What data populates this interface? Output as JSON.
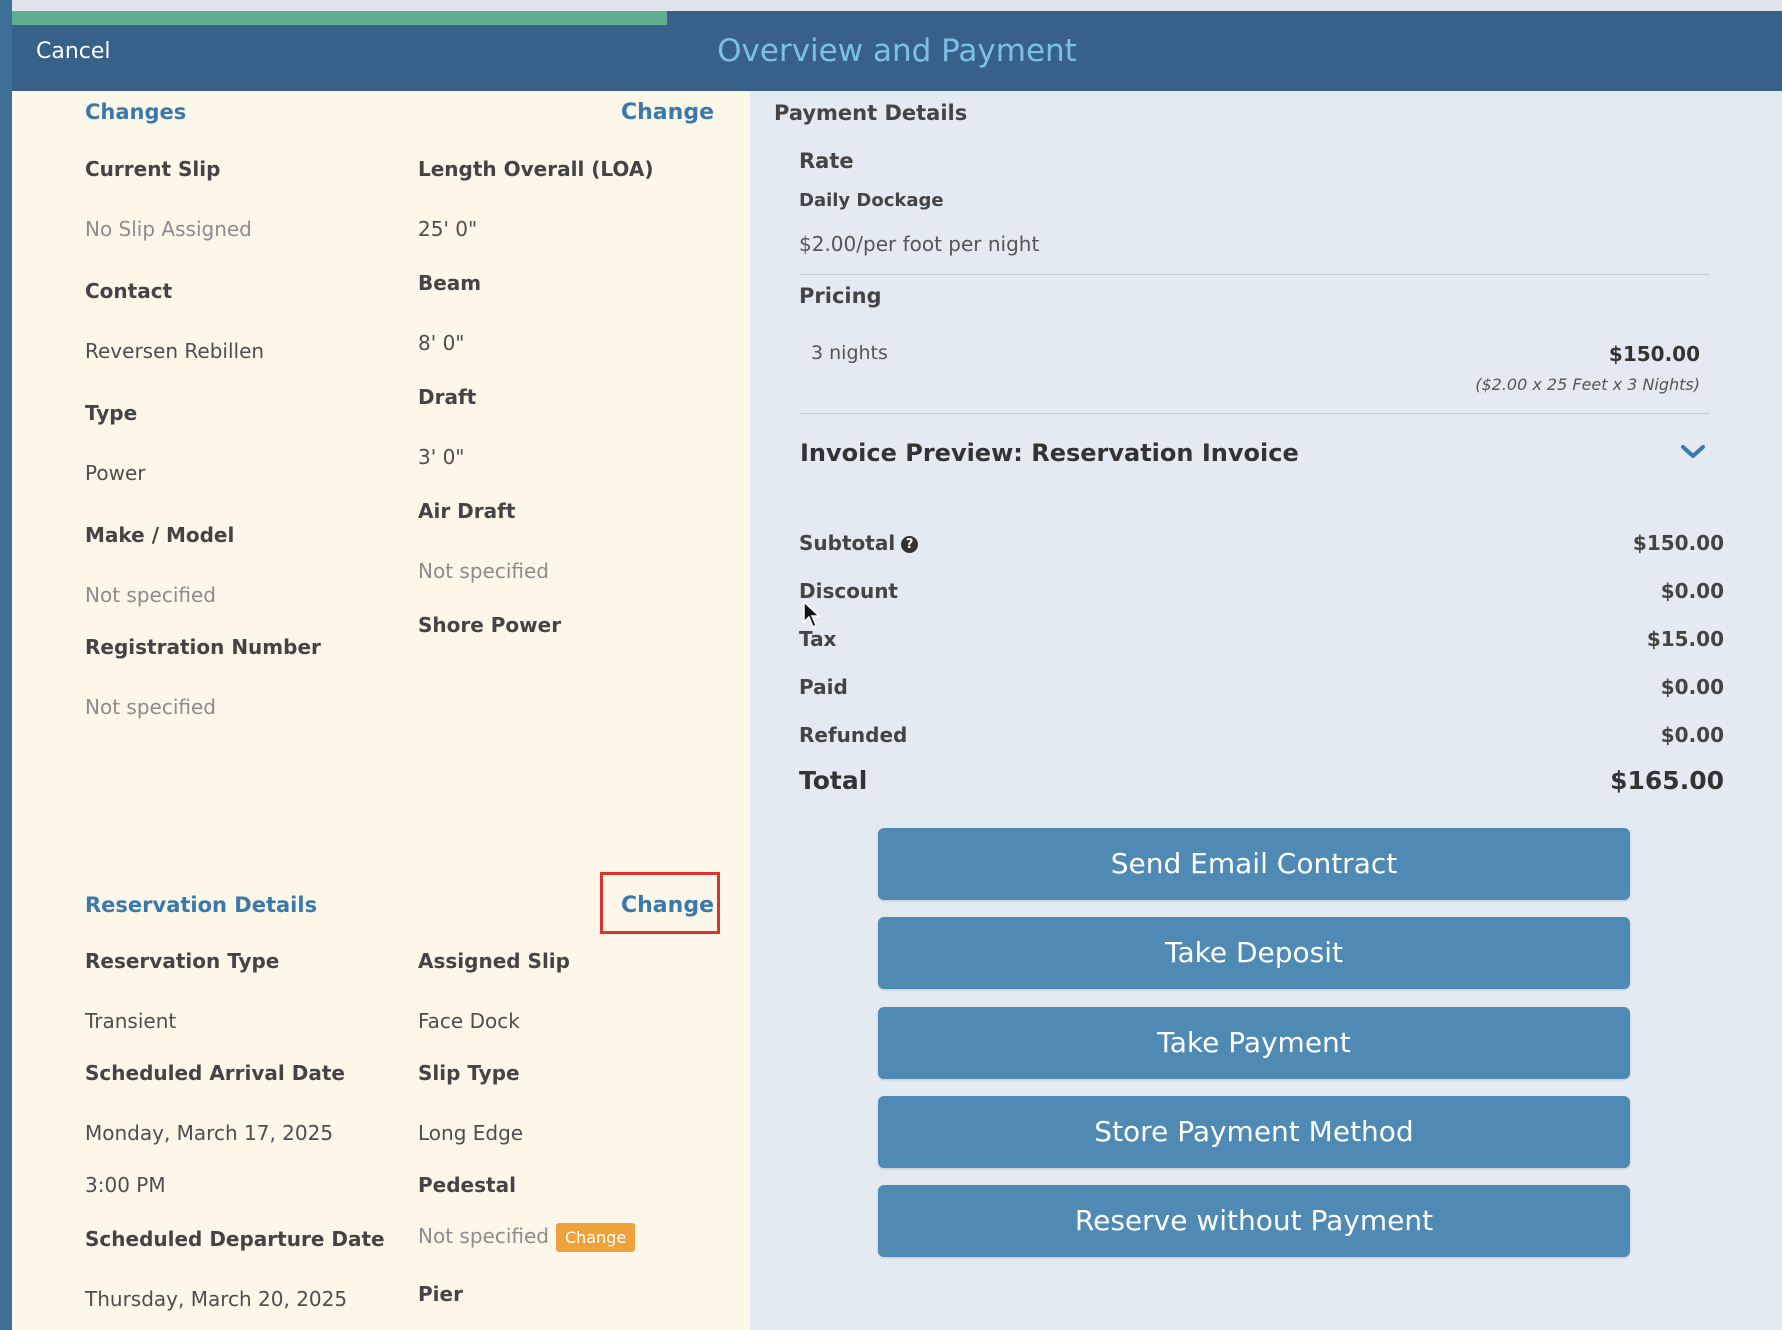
{
  "header": {
    "cancel_label": "Cancel",
    "title": "Overview and Payment",
    "progress": 0.37
  },
  "changes": {
    "title": "Changes",
    "change_link": "Change",
    "current_slip_label": "Current Slip",
    "current_slip_value": "No Slip Assigned",
    "contact_label": "Contact",
    "contact_value": "Reversen Rebillen",
    "type_label": "Type",
    "type_value": "Power",
    "make_model_label": "Make / Model",
    "make_model_value": "Not specified",
    "registration_label": "Registration Number",
    "registration_value": "Not specified",
    "loa_label": "Length Overall (LOA)",
    "loa_value": "25' 0\"",
    "beam_label": "Beam",
    "beam_value": "8' 0\"",
    "draft_label": "Draft",
    "draft_value": "3' 0\"",
    "air_draft_label": "Air Draft",
    "air_draft_value": "Not specified",
    "shore_power_label": "Shore Power"
  },
  "reservation": {
    "title": "Reservation Details",
    "change_link": "Change",
    "type_label": "Reservation Type",
    "type_value": "Transient",
    "arrival_label": "Scheduled Arrival Date",
    "arrival_date": "Monday, March 17, 2025",
    "arrival_time": "3:00 PM",
    "departure_label": "Scheduled Departure Date",
    "departure_date": "Thursday, March 20, 2025",
    "assigned_slip_label": "Assigned Slip",
    "assigned_slip_value": "Face Dock",
    "slip_type_label": "Slip Type",
    "slip_type_value": "Long Edge",
    "pedestal_label": "Pedestal",
    "pedestal_value": "Not specified",
    "pedestal_change": "Change",
    "pier_label": "Pier"
  },
  "payment": {
    "title": "Payment Details",
    "rate_label": "Rate",
    "rate_name": "Daily Dockage",
    "rate_value": "$2.00/per foot per night",
    "pricing_label": "Pricing",
    "nights": "3 nights",
    "nights_amount": "$150.00",
    "calc_note": "($2.00 x 25 Feet x 3 Nights)",
    "invoice_preview": "Invoice Preview: Reservation Invoice",
    "subtotal_label": "Subtotal",
    "subtotal_value": "$150.00",
    "discount_label": "Discount",
    "discount_value": "$0.00",
    "tax_label": "Tax",
    "tax_value": "$15.00",
    "paid_label": "Paid",
    "paid_value": "$0.00",
    "refunded_label": "Refunded",
    "refunded_value": "$0.00",
    "total_label": "Total",
    "total_value": "$165.00"
  },
  "buttons": {
    "send_email": "Send Email Contract",
    "take_deposit": "Take Deposit",
    "take_payment": "Take Payment",
    "store_method": "Store Payment Method",
    "reserve_without": "Reserve without Payment"
  }
}
